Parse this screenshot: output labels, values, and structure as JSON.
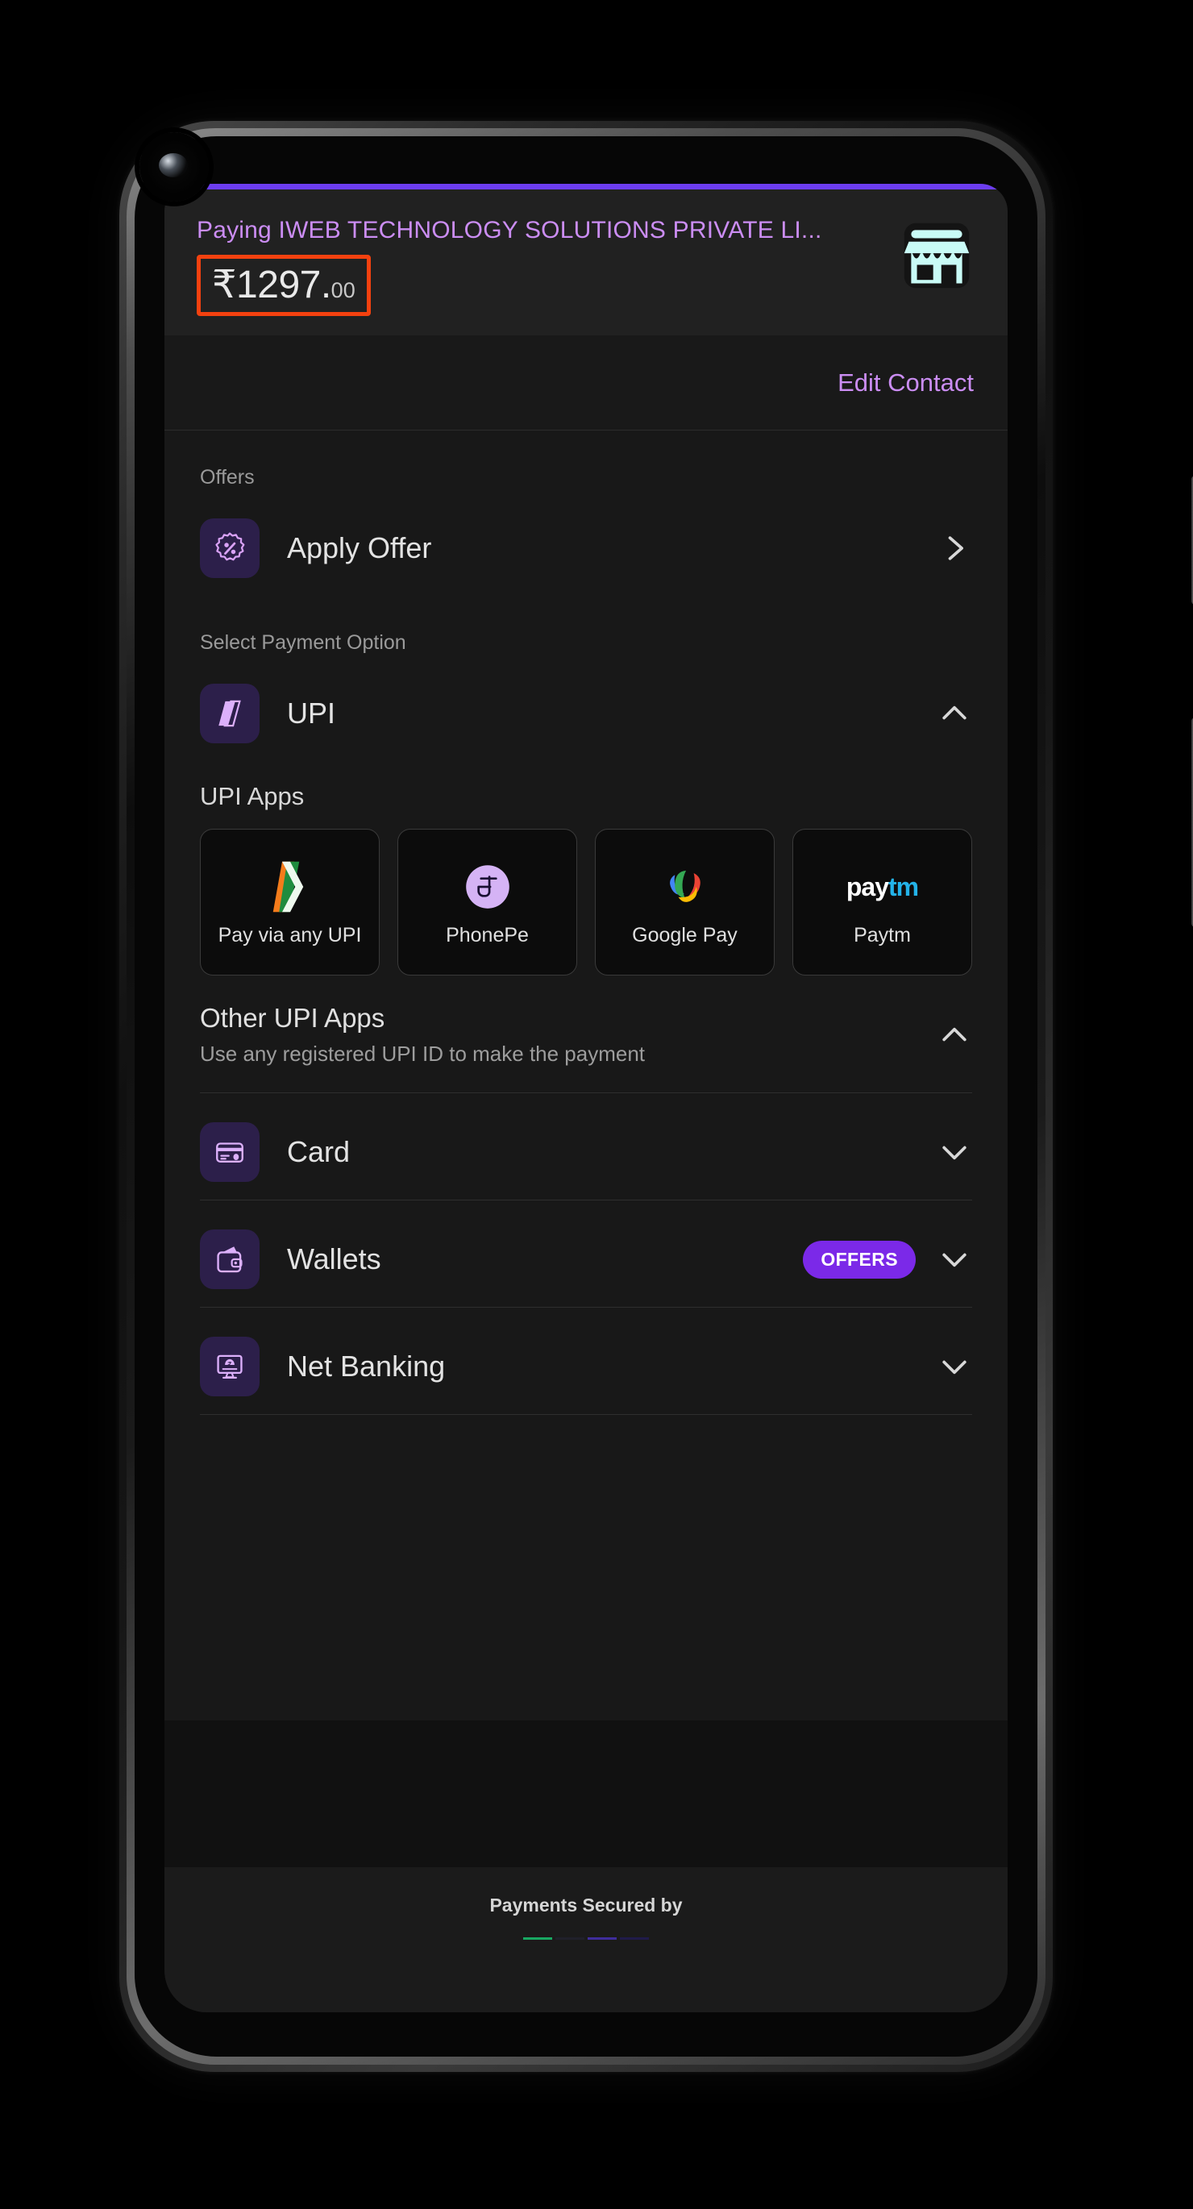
{
  "header": {
    "merchant_line": "Paying IWEB TECHNOLOGY SOLUTIONS PRIVATE LI...",
    "currency_symbol": "₹",
    "amount": "1297.",
    "amount_decimals": "00",
    "store_icon": "storefront-icon",
    "accent_color": "#6c3df0",
    "highlight_color": "#f4410f"
  },
  "contact": {
    "edit_label": "Edit Contact"
  },
  "offers": {
    "section_label": "Offers",
    "apply_offer_label": "Apply Offer",
    "apply_offer_icon": "percent-badge-icon",
    "chevron": "chevron-right-icon"
  },
  "payment": {
    "section_label": "Select Payment Option",
    "upi": {
      "label": "UPI",
      "icon": "upi-logo-icon",
      "chevron": "chevron-up-icon",
      "apps_title": "UPI Apps",
      "apps": [
        {
          "name": "Pay via any UPI",
          "icon": "bhim-upi-icon"
        },
        {
          "name": "PhonePe",
          "icon": "phonepe-icon"
        },
        {
          "name": "Google Pay",
          "icon": "google-pay-icon"
        },
        {
          "name": "Paytm",
          "icon": "paytm-icon",
          "text_pay": "pay",
          "text_tm": "tm"
        }
      ],
      "other": {
        "title": "Other UPI Apps",
        "subtitle": "Use any registered UPI ID to make the payment",
        "chevron": "chevron-up-icon"
      }
    },
    "methods": [
      {
        "label": "Card",
        "icon": "credit-card-icon",
        "chevron": "chevron-down-icon",
        "badge": ""
      },
      {
        "label": "Wallets",
        "icon": "wallet-icon",
        "chevron": "chevron-down-icon",
        "badge": "OFFERS"
      },
      {
        "label": "Net Banking",
        "icon": "net-banking-icon",
        "chevron": "chevron-down-icon",
        "badge": ""
      }
    ],
    "badge_color": "#7b29e8"
  },
  "footer": {
    "secured_text": "Payments Secured by"
  }
}
